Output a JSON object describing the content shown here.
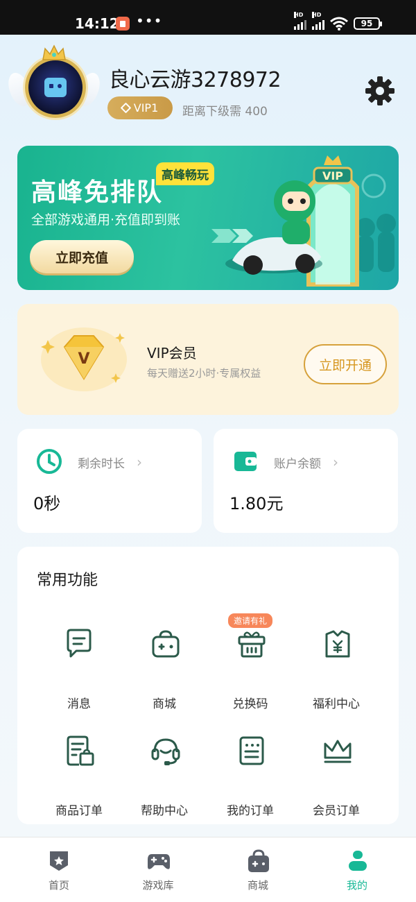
{
  "status_bar": {
    "time": "14:12",
    "dots": "•••",
    "battery": "95",
    "hd": "HD"
  },
  "profile": {
    "username": "良心云游3278972",
    "vip_level": "VIP1",
    "next_level_text": "距离下级需 400"
  },
  "banner": {
    "title": "高峰免排队",
    "tag": "高峰畅玩",
    "subtitle": "全部游戏通用·充值即到账",
    "button": "立即充值",
    "sign": "VIP"
  },
  "vip_card": {
    "title": "VIP会员",
    "subtitle": "每天赠送2小时·专属权益",
    "button": "立即开通"
  },
  "stats": [
    {
      "label": "剩余时长",
      "value": "0秒"
    },
    {
      "label": "账户余额",
      "value": "1.80元"
    }
  ],
  "functions": {
    "title": "常用功能",
    "items": [
      {
        "label": "消息",
        "icon": "message-icon"
      },
      {
        "label": "商城",
        "icon": "shop-bag-icon"
      },
      {
        "label": "兑换码",
        "icon": "gift-box-icon",
        "badge": "邀请有礼"
      },
      {
        "label": "福利中心",
        "icon": "welfare-icon"
      },
      {
        "label": "商品订单",
        "icon": "product-order-icon"
      },
      {
        "label": "帮助中心",
        "icon": "headset-icon"
      },
      {
        "label": "我的订单",
        "icon": "order-list-icon"
      },
      {
        "label": "会员订单",
        "icon": "crown-icon"
      }
    ]
  },
  "bottom_nav": [
    {
      "label": "首页",
      "icon": "home-shield-icon",
      "active": false
    },
    {
      "label": "游戏库",
      "icon": "gamepad-icon",
      "active": false
    },
    {
      "label": "商城",
      "icon": "shop-bag-icon",
      "active": false
    },
    {
      "label": "我的",
      "icon": "user-icon",
      "active": true
    }
  ],
  "colors": {
    "accent": "#18b896",
    "gold": "#d6a13b",
    "icon_dark": "#2b5a4a"
  }
}
